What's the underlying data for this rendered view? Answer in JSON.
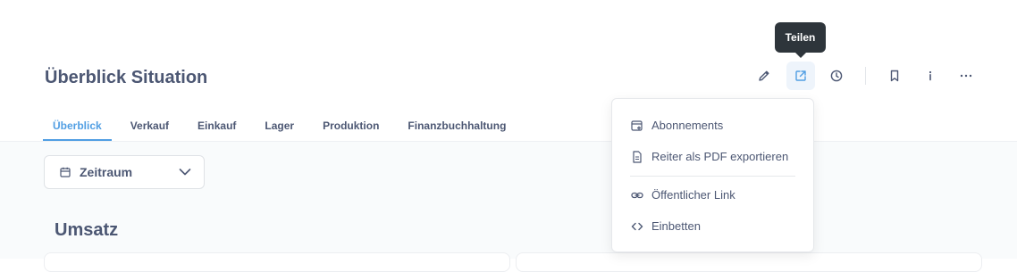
{
  "dashboard": {
    "title": "Überblick Situation",
    "tabs": [
      {
        "label": "Überblick",
        "active": true
      },
      {
        "label": "Verkauf",
        "active": false
      },
      {
        "label": "Einkauf",
        "active": false
      },
      {
        "label": "Lager",
        "active": false
      },
      {
        "label": "Produktion",
        "active": false
      },
      {
        "label": "Finanzbuchhaltung",
        "active": false
      }
    ],
    "section_title": "Umsatz"
  },
  "header_icons": [
    "pencil-icon",
    "share-icon",
    "clock-icon",
    "bookmark-icon",
    "info-icon",
    "more-icon"
  ],
  "tooltip": {
    "text": "Teilen"
  },
  "filter": {
    "label": "Zeitraum",
    "icon": "calendar-icon"
  },
  "share_menu": {
    "items": [
      {
        "label": "Abonnements",
        "icon": "subscription-icon"
      },
      {
        "label": "Reiter als PDF exportieren",
        "icon": "document-icon"
      },
      {
        "label": "Öffentlicher Link",
        "icon": "link-icon"
      },
      {
        "label": "Einbetten",
        "icon": "embed-icon"
      }
    ]
  },
  "colors": {
    "accent": "#509ee3",
    "text": "#4c5773",
    "tooltip_bg": "#2e353b"
  }
}
